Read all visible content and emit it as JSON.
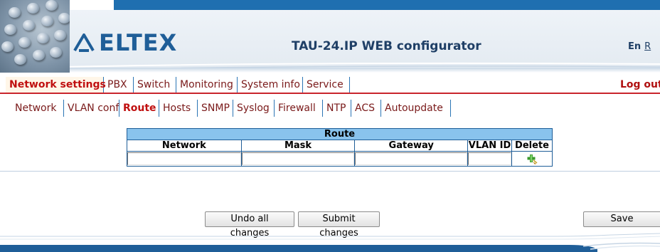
{
  "header": {
    "logo_text": "ELTEX",
    "app_title": "TAU-24.IP WEB configurator",
    "lang_en": "En",
    "lang_ru": "R"
  },
  "main_menu": {
    "items": [
      {
        "label": "Network settings",
        "active": true
      },
      {
        "label": "PBX"
      },
      {
        "label": "Switch"
      },
      {
        "label": "Monitoring"
      },
      {
        "label": "System info"
      },
      {
        "label": "Service"
      }
    ],
    "logout": "Log out"
  },
  "sub_menu": {
    "items": [
      {
        "label": "Network"
      },
      {
        "label": "VLAN conf"
      },
      {
        "label": "Route",
        "active": true
      },
      {
        "label": "Hosts"
      },
      {
        "label": "SNMP"
      },
      {
        "label": "Syslog"
      },
      {
        "label": "Firewall"
      },
      {
        "label": "NTP"
      },
      {
        "label": "ACS"
      },
      {
        "label": "Autoupdate"
      }
    ]
  },
  "route_table": {
    "title": "Route",
    "columns": [
      "Network",
      "Mask",
      "Gateway",
      "VLAN ID",
      "Delete"
    ],
    "new_row": {
      "network": "",
      "mask": "",
      "gateway": "",
      "vlan_id": ""
    },
    "add_icon": "add-route-icon"
  },
  "buttons": {
    "undo": "Undo all changes",
    "submit": "Submit changes",
    "save": "Save"
  },
  "colors": {
    "brand_blue": "#1f5e98",
    "menu_red": "#c01010",
    "table_header": "#89c3ed",
    "stripe_blue": "#1f6fb0"
  }
}
